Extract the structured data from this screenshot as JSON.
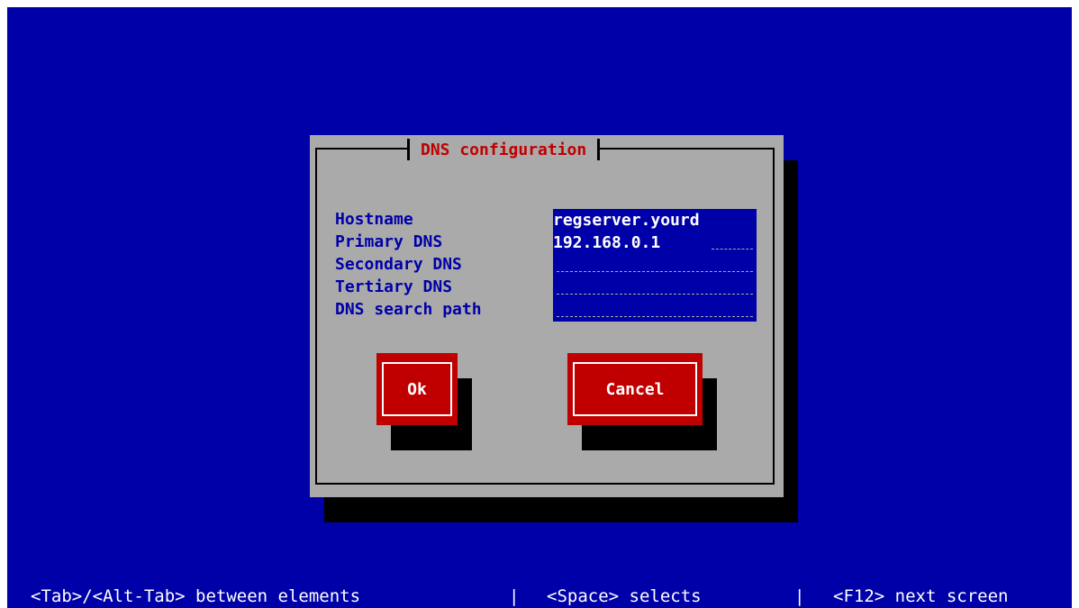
{
  "dialog": {
    "title": "DNS configuration",
    "fields": [
      {
        "label": "Hostname",
        "value": "regserver.yourd"
      },
      {
        "label": "Primary DNS",
        "value": "192.168.0.1"
      },
      {
        "label": "Secondary DNS",
        "value": ""
      },
      {
        "label": "Tertiary DNS",
        "value": ""
      },
      {
        "label": "DNS search path",
        "value": ""
      }
    ],
    "buttons": {
      "ok": "Ok",
      "cancel": "Cancel"
    }
  },
  "status_bar": {
    "tab_hint": "<Tab>/<Alt-Tab> between elements",
    "sep1": "|",
    "space_hint": "<Space> selects",
    "sep2": "|",
    "f12_hint": "<F12> next screen"
  },
  "colors": {
    "background": "#0000a8",
    "dialog": "#aaaaaa",
    "title_text": "#c00000",
    "button": "#c00000",
    "field_bg": "#0000a8",
    "field_text": "#ffffff"
  }
}
